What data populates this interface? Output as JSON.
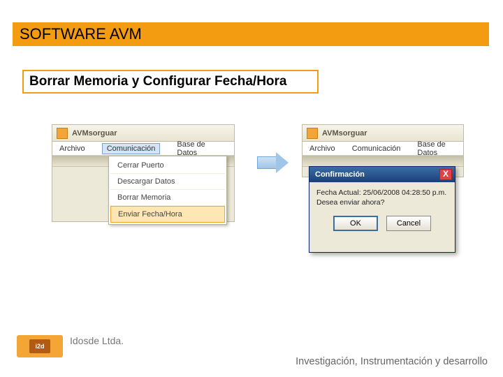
{
  "header": {
    "title": "SOFTWARE AVM"
  },
  "subtitle": "Borrar Memoria y Configurar Fecha/Hora",
  "leftApp": {
    "appName": "AVMsorguar",
    "menubar": {
      "file": "Archivo",
      "comm": "Comunicación",
      "db": "Base de Datos"
    },
    "menuItems": {
      "m0": "Cerrar Puerto",
      "m1": "Descargar Datos",
      "m2": "Borrar Memoria",
      "m3": "Enviar Fecha/Hora"
    }
  },
  "rightApp": {
    "appName": "AVMsorguar",
    "menubar": {
      "file": "Archivo",
      "comm": "Comunicación",
      "db": "Base de Datos"
    }
  },
  "dialog": {
    "title": "Confirmación",
    "close": "X",
    "line1": "Fecha Actual: 25/06/2008 04:28:50 p.m.",
    "line2": "Desea enviar ahora?",
    "ok": "OK",
    "cancel": "Cancel"
  },
  "footer": {
    "logoText": "i2d",
    "company": "Idosde Ltda.",
    "tagline": "Investigación, Instrumentación y desarrollo"
  }
}
